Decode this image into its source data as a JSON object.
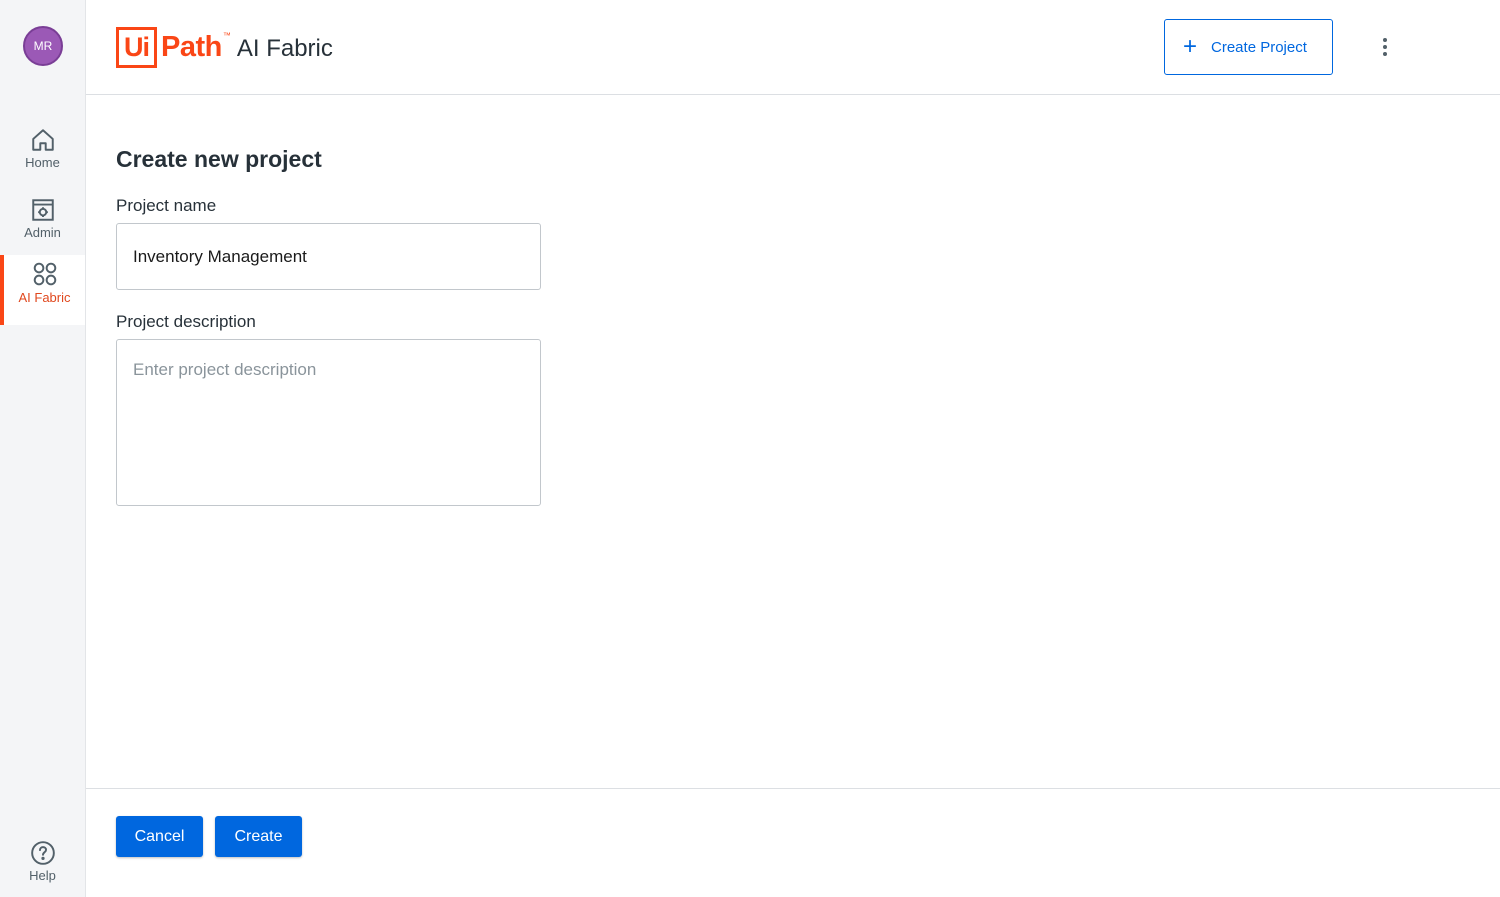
{
  "user": {
    "initials": "MR",
    "avatar_color": "#9b59b6"
  },
  "sidebar": {
    "items": [
      {
        "label": "Home",
        "icon": "home-icon"
      },
      {
        "label": "Admin",
        "icon": "admin-icon"
      },
      {
        "label": "AI Fabric",
        "icon": "ai-fabric-icon",
        "active": true
      },
      {
        "label": "Help",
        "icon": "help-icon"
      }
    ]
  },
  "header": {
    "logo_ui": "Ui",
    "logo_path": "Path",
    "logo_tm": "™",
    "product": "AI Fabric",
    "create_button_label": "Create Project",
    "more_icon": "more-vertical-icon"
  },
  "form": {
    "title": "Create new project",
    "name_label": "Project name",
    "name_value": "Inventory Management",
    "description_label": "Project description",
    "description_placeholder": "Enter project description",
    "description_value": ""
  },
  "footer": {
    "cancel_label": "Cancel",
    "create_label": "Create"
  },
  "colors": {
    "brand_orange": "#fa4616",
    "primary_blue": "#0067df",
    "sidebar_bg": "#f4f5f7"
  }
}
